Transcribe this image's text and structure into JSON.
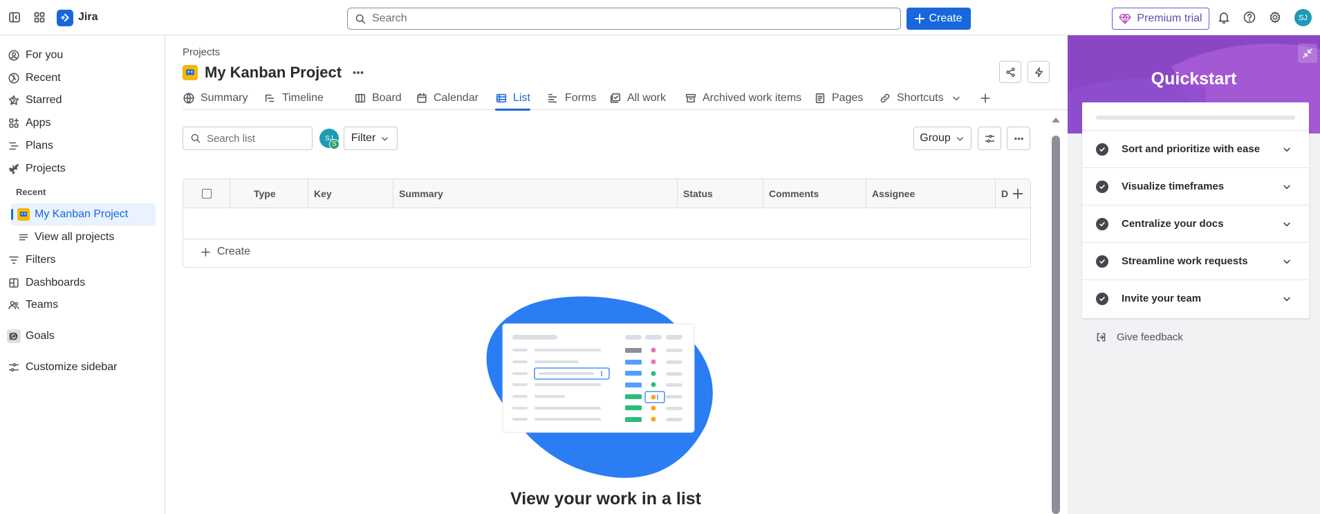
{
  "app": {
    "name": "Jira"
  },
  "topbar": {
    "search_placeholder": "Search",
    "create_label": "Create",
    "premium_label": "Premium trial",
    "avatar_initials": "SJ"
  },
  "sidebar": {
    "items": [
      {
        "label": "For you"
      },
      {
        "label": "Recent"
      },
      {
        "label": "Starred"
      },
      {
        "label": "Apps"
      },
      {
        "label": "Plans"
      },
      {
        "label": "Projects"
      }
    ],
    "recent_heading": "Recent",
    "recent_project": "My Kanban Project",
    "view_all": "View all projects",
    "items2": [
      {
        "label": "Filters"
      },
      {
        "label": "Dashboards"
      },
      {
        "label": "Teams"
      },
      {
        "label": "Goals"
      },
      {
        "label": "Customize sidebar"
      }
    ]
  },
  "main": {
    "breadcrumb": "Projects",
    "project_title": "My Kanban Project",
    "tabs": [
      {
        "label": "Summary",
        "icon": "globe-icon"
      },
      {
        "label": "Timeline",
        "icon": "timeline-icon"
      },
      {
        "label": "Board",
        "icon": "board-icon"
      },
      {
        "label": "Calendar",
        "icon": "calendar-icon"
      },
      {
        "label": "List",
        "icon": "list-icon",
        "active": true
      },
      {
        "label": "Forms",
        "icon": "forms-icon"
      },
      {
        "label": "All work",
        "icon": "all-work-icon"
      },
      {
        "label": "Archived work items",
        "icon": "archive-icon"
      },
      {
        "label": "Pages",
        "icon": "pages-icon"
      },
      {
        "label": "Shortcuts",
        "icon": "link-icon"
      }
    ],
    "list_search_placeholder": "Search list",
    "filter_avatar": "SJ",
    "filter_avatar_badge": "S",
    "filter_label": "Filter",
    "group_label": "Group",
    "table": {
      "columns": [
        "Type",
        "Key",
        "Summary",
        "Status",
        "Comments",
        "Assignee",
        "Du"
      ],
      "rows": [],
      "create_label": "Create"
    },
    "empty_title": "View your work in a list"
  },
  "quickstart": {
    "title": "Quickstart",
    "items": [
      {
        "label": "Sort and prioritize with ease"
      },
      {
        "label": "Visualize timeframes"
      },
      {
        "label": "Centralize your docs"
      },
      {
        "label": "Streamline work requests"
      },
      {
        "label": "Invite your team"
      }
    ],
    "feedback_label": "Give feedback"
  },
  "colors": {
    "brand_blue": "#1868db",
    "premium_purple": "#6a56d6",
    "quickstart_purple": "#8b46c4",
    "project_icon": "#f5b700"
  }
}
